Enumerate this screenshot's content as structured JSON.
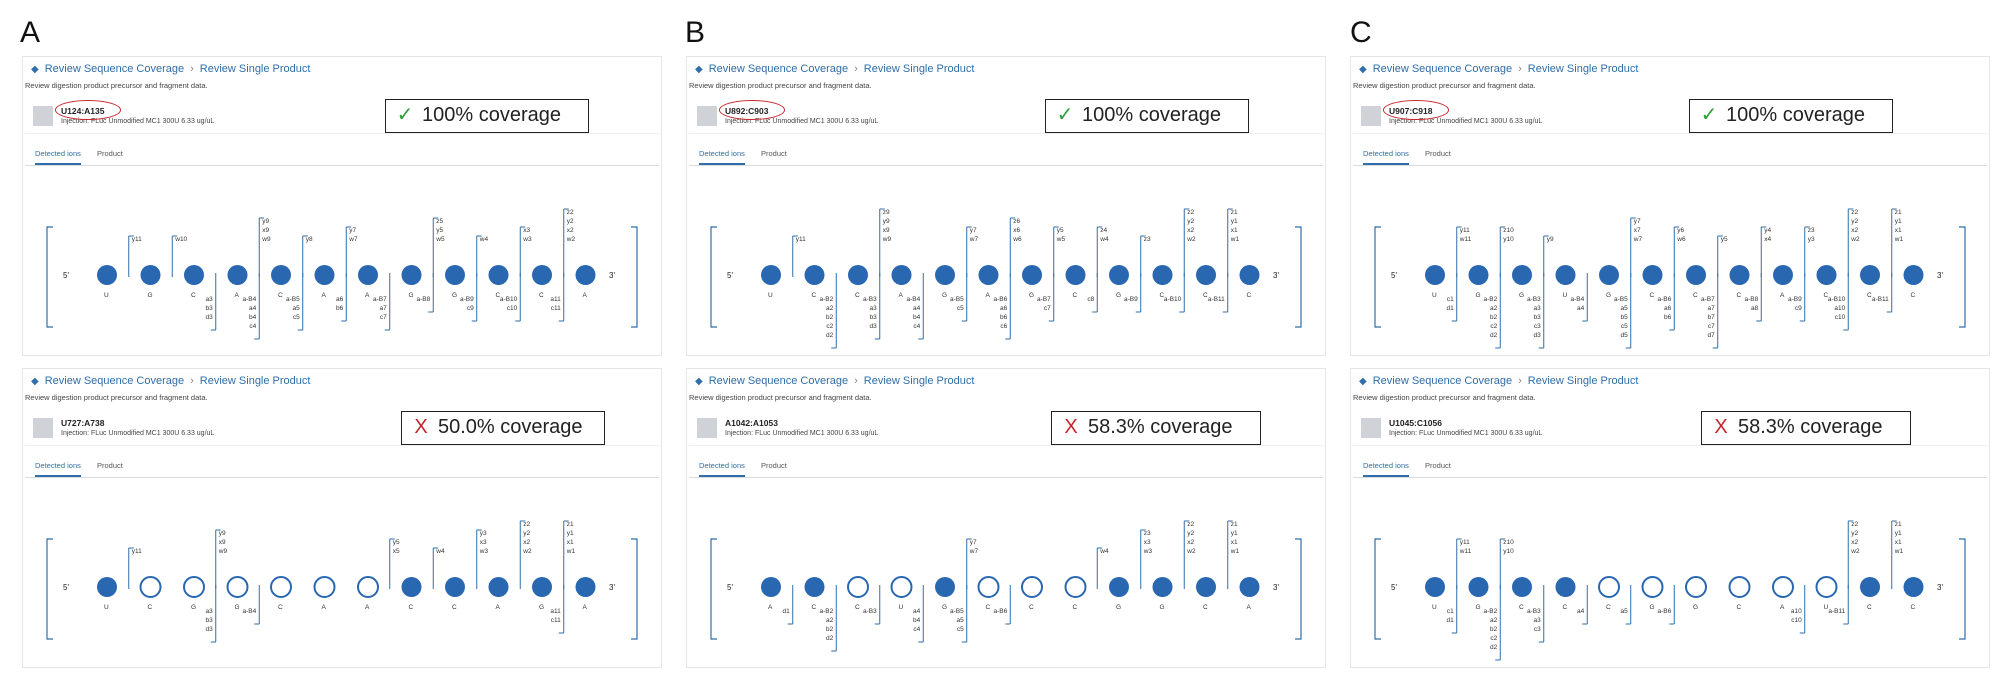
{
  "panel_letters": [
    "A",
    "B",
    "C"
  ],
  "common": {
    "back_arrow": "back-arrow-icon",
    "crumb_parent": "Review Sequence Coverage",
    "crumb_child": "Review Single Product",
    "subtitle": "Review digestion product precursor and fragment data.",
    "tab_detected": "Detected ions",
    "tab_product": "Product",
    "end5": "5'",
    "end3": "3'",
    "colors": {
      "node": "#2a67b1",
      "bracket": "#2f6ea8",
      "accent": "#2f6ea8",
      "check": "#2e9e3c",
      "x": "#c8242b"
    }
  },
  "cards": [
    {
      "name": "U124:A135",
      "circled": true,
      "injection": "Injection: FLuc Unmodified MC1 300U 6.33 ug/uL",
      "cov_mark": "✓",
      "cov_mark_type": "check",
      "coverage": "100% coverage",
      "seq": [
        "U",
        "G",
        "C",
        "A",
        "C",
        "A",
        "A",
        "G",
        "G",
        "C",
        "C",
        "A"
      ],
      "filled": [
        1,
        1,
        1,
        1,
        1,
        1,
        1,
        1,
        1,
        1,
        1,
        1
      ],
      "upper": [
        [
          "y11"
        ],
        [
          "w10"
        ],
        [],
        [
          "y9",
          "x9",
          "w9"
        ],
        [
          "y8"
        ],
        [
          "y7",
          "w7"
        ],
        [],
        [
          "z5",
          "y5",
          "w5"
        ],
        [
          "w4"
        ],
        [
          "x3",
          "w3"
        ],
        [
          "z2",
          "y2",
          "x2",
          "w2"
        ],
        [
          "z1",
          "y1",
          "x1",
          "w1"
        ]
      ],
      "lower": [
        [],
        [],
        [
          "a3",
          "b3",
          "d3"
        ],
        [
          "a-B4",
          "a4",
          "b4",
          "c4"
        ],
        [
          "a-B5",
          "a5",
          "c5"
        ],
        [
          "a6",
          "b6"
        ],
        [
          "a-B7",
          "a7",
          "c7"
        ],
        [
          "a-B8"
        ],
        [
          "a-B9",
          "c9"
        ],
        [
          "a-B10",
          "c10"
        ],
        [
          "a11",
          "c11"
        ],
        []
      ]
    },
    {
      "name": "U892:C903",
      "circled": true,
      "injection": "Injection: FLuc Unmodified MC1 300U 6.33 ug/uL",
      "cov_mark": "✓",
      "cov_mark_type": "check",
      "coverage": "100% coverage",
      "seq": [
        "U",
        "C",
        "C",
        "A",
        "G",
        "A",
        "G",
        "C",
        "G",
        "C",
        "C",
        "C"
      ],
      "filled": [
        1,
        1,
        1,
        1,
        1,
        1,
        1,
        1,
        1,
        1,
        1,
        1
      ],
      "upper": [
        [
          "y11"
        ],
        [],
        [
          "z9",
          "y9",
          "x9",
          "w9"
        ],
        [],
        [
          "y7",
          "w7"
        ],
        [
          "z6",
          "x6",
          "w6"
        ],
        [
          "y5",
          "w5"
        ],
        [
          "z4",
          "w4"
        ],
        [
          "z3"
        ],
        [
          "z2",
          "y2",
          "x2",
          "w2"
        ],
        [
          "z1",
          "y1",
          "x1",
          "w1"
        ],
        []
      ],
      "lower": [
        [],
        [
          "a-B2",
          "a2",
          "b2",
          "c2",
          "d2"
        ],
        [
          "a-B3",
          "a3",
          "b3",
          "d3"
        ],
        [
          "a-B4",
          "a4",
          "b4",
          "c4"
        ],
        [
          "a-B5",
          "c5"
        ],
        [
          "a-B6",
          "a6",
          "b6",
          "c6"
        ],
        [
          "a-B7",
          "c7"
        ],
        [
          "c8"
        ],
        [
          "a-B9"
        ],
        [
          "a-B10"
        ],
        [
          "a-B11"
        ],
        []
      ]
    },
    {
      "name": "U907:C918",
      "circled": true,
      "injection": "Injection: FLuc Unmodified MC1 300U 6.33 ug/uL",
      "cov_mark": "✓",
      "cov_mark_type": "check",
      "coverage": "100% coverage",
      "seq": [
        "U",
        "G",
        "G",
        "U",
        "G",
        "C",
        "C",
        "C",
        "A",
        "C",
        "C",
        "C"
      ],
      "filled": [
        1,
        1,
        1,
        1,
        1,
        1,
        1,
        1,
        1,
        1,
        1,
        1
      ],
      "upper": [
        [
          "y11",
          "w11"
        ],
        [
          "z10",
          "y10"
        ],
        [
          "y9"
        ],
        [],
        [
          "y7",
          "x7",
          "w7"
        ],
        [
          "y6",
          "w6"
        ],
        [
          "y5"
        ],
        [
          "y4",
          "x4"
        ],
        [
          "z3",
          "y3"
        ],
        [
          "z2",
          "y2",
          "x2",
          "w2"
        ],
        [
          "z1",
          "y1",
          "x1",
          "w1"
        ],
        []
      ],
      "lower": [
        [
          "c1",
          "d1"
        ],
        [
          "a-B2",
          "a2",
          "b2",
          "c2",
          "d2"
        ],
        [
          "a-B3",
          "a3",
          "b3",
          "c3",
          "d3"
        ],
        [
          "a-B4",
          "a4"
        ],
        [
          "a-B5",
          "a5",
          "b5",
          "c5",
          "d5"
        ],
        [
          "a-B6",
          "a6",
          "b6"
        ],
        [
          "a-B7",
          "a7",
          "b7",
          "c7",
          "d7"
        ],
        [
          "a-B8",
          "a8"
        ],
        [
          "a-B9",
          "c9"
        ],
        [
          "a-B10",
          "a10",
          "c10"
        ],
        [
          "a-B11"
        ],
        []
      ]
    },
    {
      "name": "U727:A738",
      "circled": false,
      "injection": "Injection: FLuc Unmodified MC1 300U 6.33 ug/uL",
      "cov_mark": "X",
      "cov_mark_type": "x",
      "coverage": "50.0% coverage",
      "seq": [
        "U",
        "C",
        "G",
        "G",
        "C",
        "A",
        "A",
        "C",
        "C",
        "A",
        "G",
        "A"
      ],
      "filled": [
        1,
        0,
        0,
        0,
        0,
        0,
        0,
        1,
        1,
        1,
        1,
        1
      ],
      "upper": [
        [
          "y11"
        ],
        [],
        [
          "y9",
          "x9",
          "w9"
        ],
        [],
        [],
        [],
        [
          "y5",
          "x5"
        ],
        [
          "w4"
        ],
        [
          "y3",
          "x3",
          "w3"
        ],
        [
          "z2",
          "y2",
          "x2",
          "w2"
        ],
        [
          "z1",
          "y1",
          "x1",
          "w1"
        ],
        []
      ],
      "lower": [
        [],
        [],
        [
          "a3",
          "b3",
          "d3"
        ],
        [
          "a-B4"
        ],
        [],
        [],
        [],
        [],
        [],
        [],
        [
          "a11",
          "c11"
        ],
        []
      ]
    },
    {
      "name": "A1042:A1053",
      "circled": false,
      "injection": "Injection: FLuc Unmodified MC1 300U 6.33 ug/uL",
      "cov_mark": "X",
      "cov_mark_type": "x",
      "coverage": "58.3% coverage",
      "seq": [
        "A",
        "C",
        "C",
        "U",
        "G",
        "C",
        "C",
        "C",
        "G",
        "G",
        "C",
        "A"
      ],
      "filled": [
        1,
        1,
        0,
        0,
        1,
        0,
        0,
        0,
        1,
        1,
        1,
        1
      ],
      "upper": [
        [],
        [],
        [],
        [],
        [
          "y7",
          "w7"
        ],
        [],
        [],
        [
          "w4"
        ],
        [
          "z3",
          "x3",
          "w3"
        ],
        [
          "z2",
          "y2",
          "x2",
          "w2"
        ],
        [
          "z1",
          "y1",
          "x1",
          "w1"
        ],
        []
      ],
      "lower": [
        [
          "d1"
        ],
        [
          "a-B2",
          "a2",
          "b2",
          "d2"
        ],
        [
          "a-B3"
        ],
        [
          "a4",
          "b4",
          "c4"
        ],
        [
          "a-B5",
          "a5",
          "c5"
        ],
        [
          "a-B6"
        ],
        [],
        [],
        [],
        [],
        [],
        []
      ]
    },
    {
      "name": "U1045:C1056",
      "circled": false,
      "injection": "Injection: FLuc Unmodified MC1 300U 6.33 ug/uL",
      "cov_mark": "X",
      "cov_mark_type": "x",
      "coverage": "58.3% coverage",
      "seq": [
        "U",
        "G",
        "C",
        "C",
        "C",
        "G",
        "G",
        "C",
        "A",
        "U",
        "C",
        "C"
      ],
      "filled": [
        1,
        1,
        1,
        1,
        0,
        0,
        0,
        0,
        0,
        0,
        1,
        1
      ],
      "upper": [
        [
          "y11",
          "w11"
        ],
        [
          "z10",
          "y10"
        ],
        [],
        [],
        [],
        [],
        [],
        [],
        [],
        [
          "z2",
          "y2",
          "x2",
          "w2"
        ],
        [
          "z1",
          "y1",
          "x1",
          "w1"
        ],
        []
      ],
      "lower": [
        [
          "c1",
          "d1"
        ],
        [
          "a-B2",
          "a2",
          "b2",
          "c2",
          "d2"
        ],
        [
          "a-B3",
          "a3",
          "c3"
        ],
        [
          "a4"
        ],
        [
          "a5"
        ],
        [
          "a-B6"
        ],
        [],
        [],
        [
          "a10",
          "c10"
        ],
        [
          "a-B11"
        ],
        [],
        []
      ]
    }
  ]
}
